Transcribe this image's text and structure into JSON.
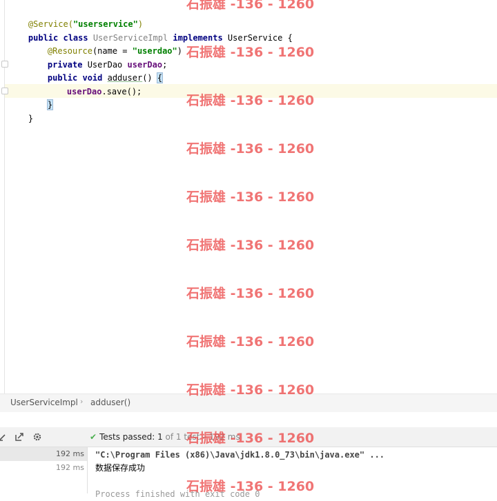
{
  "editor": {
    "lines": [
      {
        "a": "@Service(",
        "s": "\"userservice\"",
        "b": ")"
      },
      {
        "kw1": "public class ",
        "cls": "UserServiceImpl",
        "kw2": " implements ",
        "rest": "UserService {"
      },
      {
        "a": "@Resource",
        "p": "(name = ",
        "s": "\"userdao\"",
        "b": ")"
      },
      {
        "kw": "private ",
        "type": "UserDao ",
        "field": "userDao",
        "end": ";"
      },
      {
        "kw": "public void ",
        "name": "adduser",
        "rest": "() ",
        "brace": "{"
      },
      {
        "field": "userDao",
        "rest": ".save();"
      },
      {
        "brace": "}"
      },
      {
        "text": "}"
      }
    ]
  },
  "breadcrumb": {
    "items": [
      "UserServiceImpl",
      "adduser()"
    ],
    "separator": "›"
  },
  "run": {
    "status_prefix": "Tests passed: ",
    "status_count": "1",
    "status_suffix": " of 1 test – 192 ms",
    "tree": [
      {
        "time": "192 ms"
      },
      {
        "time": "192 ms"
      }
    ],
    "console": {
      "cmd": "\"C:\\Program Files (x86)\\Java\\jdk1.8.0_73\\bin\\java.exe\" ...",
      "output": "数据保存成功",
      "faint": "Process finished with exit code 0"
    }
  },
  "watermark": "石振雄 -136 - 1260",
  "colors": {
    "keyword": "#000080",
    "annotation": "#808000",
    "string": "#008000",
    "field": "#660e7a",
    "caret_row": "#fcfae6",
    "pass_check": "#4caf50",
    "watermark": "#eb4646"
  }
}
